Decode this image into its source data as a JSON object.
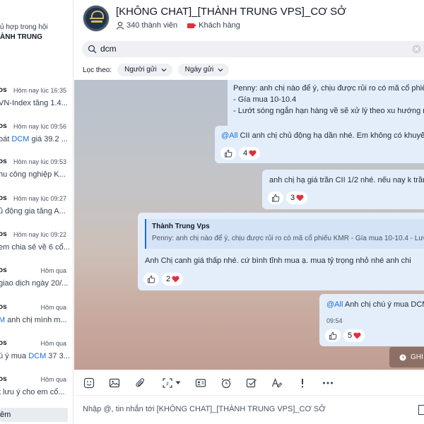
{
  "sidebar": {
    "header_line1": "ủ hợp trong hội",
    "header_line2": "ÀNH TRUNG",
    "results": [
      {
        "sender": "os",
        "time": "Hôm nay lúc 16:35",
        "snippet_before": "VN-Index tăng 1.4...",
        "highlight": "",
        "snippet_after": ""
      },
      {
        "sender": "os",
        "time": "Hôm nay lúc 09:56",
        "snippet_before": "oát ",
        "highlight": "DCM",
        "snippet_after": " giá 39.2 ..."
      },
      {
        "sender": "os",
        "time": "Hôm nay lúc 09:53",
        "snippet_before": "hu công nghiệp K...",
        "highlight": "",
        "snippet_after": ""
      },
      {
        "sender": "os",
        "time": "Hôm nay lúc 09:27",
        "snippet_before": "ủ động gia tăng A...",
        "highlight": "",
        "snippet_after": ""
      },
      {
        "sender": "os",
        "time": "Hôm nay lúc 09:22",
        "snippet_before": "em chia sẻ về 6 cổ...",
        "highlight": "",
        "snippet_after": ""
      },
      {
        "sender": "os",
        "time": "Hôm qua",
        "snippet_before": "giao dịch ngày 20/...",
        "highlight": "",
        "snippet_after": ""
      },
      {
        "sender": "os",
        "time": "Hôm qua",
        "snippet_before": "",
        "highlight": "M",
        "snippet_after": " anh chị mình m..."
      },
      {
        "sender": "os",
        "time": "Hôm qua",
        "snippet_before": "ú ý mua ",
        "highlight": "DCM",
        "snippet_after": " 37 3..."
      },
      {
        "sender": "os",
        "time": "Hôm qua",
        "snippet_before": "t lưu ý cho em cổ...",
        "highlight": "",
        "snippet_after": ""
      }
    ],
    "footer": "êm"
  },
  "header": {
    "title": "[KHÔNG CHAT]_[THÀNH TRUNG VPS]_CƠ SỞ",
    "members": "340 thành viên",
    "tag": "Khách hàng"
  },
  "search": {
    "value": "dcm"
  },
  "filters": {
    "label": "Lọc theo:",
    "sender": "Người gửi",
    "date": "Ngày gửi"
  },
  "messages": {
    "m1": {
      "line1": "Penny: anh chị nào để ý, chịu được rủi ro có mã cổ phiếu KMR",
      "line2": "- Gía mua 10-10.4",
      "line3": "- Lướt sóng ngắn hạn hàng về sẽ xử lý theo xu hướng nhé"
    },
    "m2": {
      "mention": "@All",
      "text": " CII anh chị chủ động hạ dần nhé. Em không có khuyến nghị",
      "reactions": "4"
    },
    "m3": {
      "text": "anh chị hạ giá trần CII 1/2 nhé. nếu nay k trần",
      "reactions": "3"
    },
    "m4": {
      "quote_name": "Thành Trung Vps",
      "quote_text": "Penny: anh chị nào để ý, chịu được rủi ro có mã cổ phiếu KMR - Gía mua 10-10.4 - Lướt sóng",
      "text": "Anh Chị canh giá thấp nhé. cứ bình tĩnh mua ạ. mua tỷ trọng nhỏ nhé anh chi",
      "reactions": "2"
    },
    "m5": {
      "mention": "@All",
      "text": " Anh chị chú ý mua DCM",
      "time": "09:54",
      "reactions": "5"
    }
  },
  "pinned": {
    "label": "GHI"
  },
  "composer": {
    "placeholder": "Nhập @, tin nhắn tới [KHÔNG CHAT]_[THÀNH TRUNG VPS]_CƠ SỞ"
  },
  "colors": {
    "accent": "#1a6cdf",
    "bubble": "#e4eefb",
    "heart": "#e0303d",
    "tag": "#e0303d"
  }
}
